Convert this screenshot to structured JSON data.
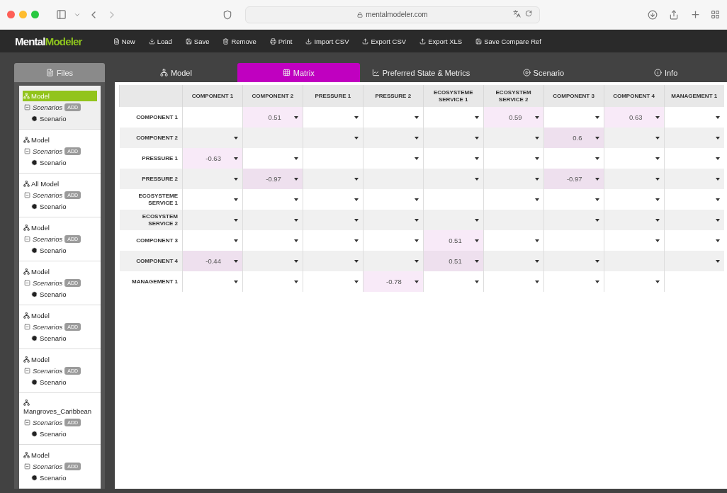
{
  "browser": {
    "url": "mentalmodeler.com"
  },
  "app": {
    "logo": {
      "first": "Mental",
      "second": "Modeler"
    },
    "toolbar": [
      {
        "label": "New"
      },
      {
        "label": "Load"
      },
      {
        "label": "Save"
      },
      {
        "label": "Remove"
      },
      {
        "label": "Print"
      },
      {
        "label": "Import CSV"
      },
      {
        "label": "Export CSV"
      },
      {
        "label": "Export XLS"
      },
      {
        "label": "Save Compare Ref"
      }
    ]
  },
  "sidebar": {
    "tab": "Files",
    "items": [
      {
        "name": "Model",
        "selected": true,
        "scenarios": "Scenarios",
        "add": "ADD",
        "scenario": "Scenario"
      },
      {
        "name": "Model",
        "selected": false,
        "scenarios": "Scenarios",
        "add": "ADD",
        "scenario": "Scenario"
      },
      {
        "name": "All Model",
        "selected": false,
        "scenarios": "Scenarios",
        "add": "ADD",
        "scenario": "Scenario"
      },
      {
        "name": "Model",
        "selected": false,
        "scenarios": "Scenarios",
        "add": "ADD",
        "scenario": "Scenario"
      },
      {
        "name": "Model",
        "selected": false,
        "scenarios": "Scenarios",
        "add": "ADD",
        "scenario": "Scenario"
      },
      {
        "name": "Model",
        "selected": false,
        "scenarios": "Scenarios",
        "add": "ADD",
        "scenario": "Scenario"
      },
      {
        "name": "Model",
        "selected": false,
        "scenarios": "Scenarios",
        "add": "ADD",
        "scenario": "Scenario"
      },
      {
        "name": "Mangroves_Caribbean",
        "selected": false,
        "scenarios": "Scenarios",
        "add": "ADD",
        "scenario": "Scenario"
      },
      {
        "name": "Model",
        "selected": false,
        "scenarios": "Scenarios",
        "add": "ADD",
        "scenario": "Scenario"
      }
    ]
  },
  "tabs": [
    {
      "label": "Model",
      "selected": false
    },
    {
      "label": "Matrix",
      "selected": true
    },
    {
      "label": "Preferred State & Metrics",
      "selected": false
    },
    {
      "label": "Scenario",
      "selected": false
    },
    {
      "label": "Info",
      "selected": false
    }
  ],
  "matrix": {
    "columns": [
      "COMPONENT 1",
      "COMPONENT 2",
      "PRESSURE 1",
      "PRESSURE 2",
      "ECOSYSTEME SERVICE 1",
      "ECOSYSTEM SERVICE 2",
      "COMPONENT 3",
      "COMPONENT 4",
      "MANAGEMENT 1"
    ],
    "rows": [
      {
        "label": "COMPONENT 1",
        "cells": [
          {
            "kind": "none"
          },
          {
            "kind": "select",
            "value": "0.51"
          },
          {
            "kind": "select"
          },
          {
            "kind": "select"
          },
          {
            "kind": "select"
          },
          {
            "kind": "select",
            "value": "0.59"
          },
          {
            "kind": "select"
          },
          {
            "kind": "select",
            "value": "0.63"
          },
          {
            "kind": "select"
          }
        ]
      },
      {
        "label": "COMPONENT 2",
        "cells": [
          {
            "kind": "select"
          },
          {
            "kind": "none"
          },
          {
            "kind": "select"
          },
          {
            "kind": "select"
          },
          {
            "kind": "select"
          },
          {
            "kind": "select"
          },
          {
            "kind": "select",
            "value": "0.6"
          },
          {
            "kind": "select"
          },
          {
            "kind": "select"
          }
        ]
      },
      {
        "label": "PRESSURE 1",
        "cells": [
          {
            "kind": "select",
            "value": "-0.63"
          },
          {
            "kind": "select"
          },
          {
            "kind": "none"
          },
          {
            "kind": "select"
          },
          {
            "kind": "select"
          },
          {
            "kind": "select"
          },
          {
            "kind": "select"
          },
          {
            "kind": "select"
          },
          {
            "kind": "select"
          }
        ]
      },
      {
        "label": "PRESSURE 2",
        "cells": [
          {
            "kind": "select"
          },
          {
            "kind": "select",
            "value": "-0.97"
          },
          {
            "kind": "select"
          },
          {
            "kind": "none"
          },
          {
            "kind": "select"
          },
          {
            "kind": "select"
          },
          {
            "kind": "select",
            "value": "-0.97"
          },
          {
            "kind": "select"
          },
          {
            "kind": "select"
          }
        ]
      },
      {
        "label": "ECOSYSTEME SERVICE 1",
        "cells": [
          {
            "kind": "select"
          },
          {
            "kind": "select"
          },
          {
            "kind": "select"
          },
          {
            "kind": "select"
          },
          {
            "kind": "none"
          },
          {
            "kind": "select"
          },
          {
            "kind": "select"
          },
          {
            "kind": "select"
          },
          {
            "kind": "select"
          }
        ]
      },
      {
        "label": "ECOSYSTEM SERVICE 2",
        "cells": [
          {
            "kind": "select"
          },
          {
            "kind": "select"
          },
          {
            "kind": "select"
          },
          {
            "kind": "select"
          },
          {
            "kind": "select"
          },
          {
            "kind": "none"
          },
          {
            "kind": "select"
          },
          {
            "kind": "select"
          },
          {
            "kind": "select"
          }
        ]
      },
      {
        "label": "COMPONENT 3",
        "cells": [
          {
            "kind": "select"
          },
          {
            "kind": "select"
          },
          {
            "kind": "select"
          },
          {
            "kind": "select"
          },
          {
            "kind": "select",
            "value": "0.51"
          },
          {
            "kind": "select"
          },
          {
            "kind": "none"
          },
          {
            "kind": "select"
          },
          {
            "kind": "select"
          }
        ]
      },
      {
        "label": "COMPONENT 4",
        "cells": [
          {
            "kind": "select",
            "value": "-0.44"
          },
          {
            "kind": "select"
          },
          {
            "kind": "select"
          },
          {
            "kind": "select"
          },
          {
            "kind": "select",
            "value": "0.51"
          },
          {
            "kind": "select"
          },
          {
            "kind": "select"
          },
          {
            "kind": "none"
          },
          {
            "kind": "select"
          }
        ]
      },
      {
        "label": "MANAGEMENT 1",
        "cells": [
          {
            "kind": "select"
          },
          {
            "kind": "select"
          },
          {
            "kind": "select"
          },
          {
            "kind": "select",
            "value": "-0.78"
          },
          {
            "kind": "select"
          },
          {
            "kind": "select"
          },
          {
            "kind": "select"
          },
          {
            "kind": "select"
          },
          {
            "kind": "none"
          }
        ]
      }
    ]
  }
}
